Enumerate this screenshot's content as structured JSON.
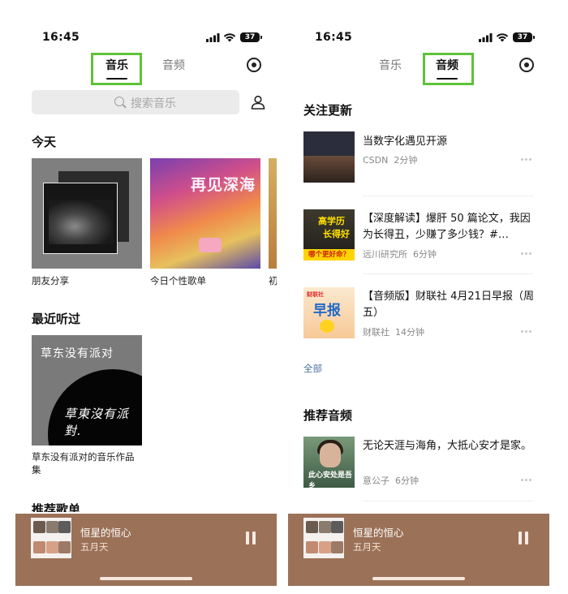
{
  "status_bar": {
    "time": "16:45",
    "battery": "37"
  },
  "screen1": {
    "tabs": {
      "music": "音乐",
      "audio": "音频"
    },
    "search_placeholder": "搜索音乐",
    "today": {
      "title": "今天",
      "cards": [
        {
          "label": "朋友分享"
        },
        {
          "label": "今日个性歌单",
          "cover_text_1": "再见深海",
          "cover_text_2": ""
        },
        {
          "label": "初"
        }
      ]
    },
    "recent": {
      "title": "最近听过",
      "card": {
        "cover_title": "草东没有派对",
        "cover_script": "草東沒有派對.",
        "label_line1": "草东没有派对的音乐作品",
        "label_line2": "集"
      }
    },
    "recommended_playlists": "推荐歌单"
  },
  "screen2": {
    "tabs": {
      "music": "音乐",
      "audio": "音频"
    },
    "follow_updates": {
      "title": "关注更新",
      "items": [
        {
          "title": "当数字化遇见开源",
          "source": "CSDN",
          "duration": "2分钟"
        },
        {
          "title": "【深度解读】爆肝 50 篇论文，我因为长得丑，少赚了多少钱？#…",
          "source": "远川研究所",
          "duration": "6分钟",
          "thumb_line1": "高学历",
          "thumb_line2": "长得好",
          "thumb_banner": "哪个更好命？"
        },
        {
          "title": "【音频版】财联社 4月21日早报（周五）",
          "source": "财联社",
          "duration": "14分钟",
          "thumb_brand": "财联社",
          "thumb_big": "早报"
        }
      ],
      "all_link": "全部"
    },
    "recommended_audio": {
      "title": "推荐音频",
      "items": [
        {
          "title": "无论天涯与海角，大抵心安才是家。",
          "source": "意公子",
          "duration": "6分钟",
          "thumb_text": "此心安处是吾乡"
        }
      ]
    }
  },
  "mini_player": {
    "song": "恒星的恒心",
    "artist": "五月天"
  },
  "colors": {
    "player_bg": "#9b7157",
    "tab_highlight": "#5ec23a",
    "link": "#4a6f9c"
  }
}
